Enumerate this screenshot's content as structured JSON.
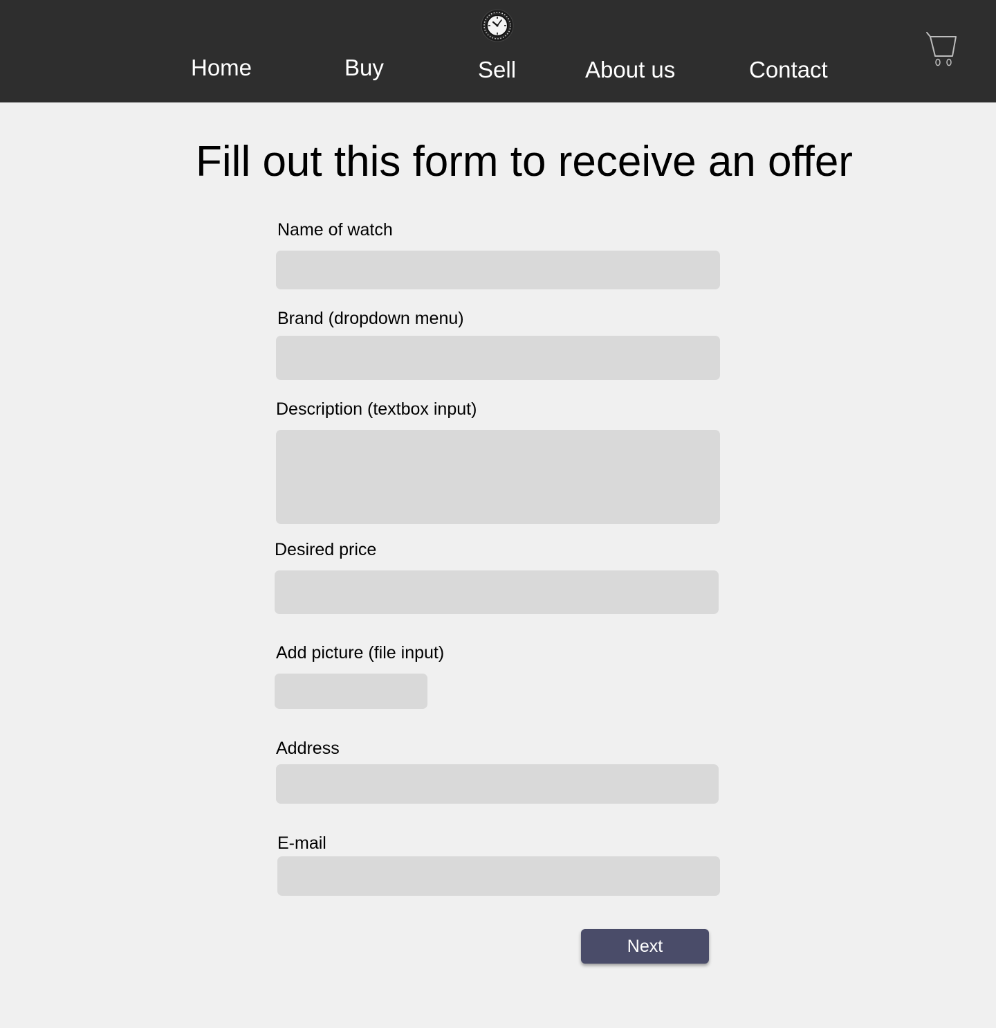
{
  "header": {
    "logo_icon": "watch-clock-icon",
    "nav": {
      "home": "Home",
      "buy": "Buy",
      "sell": "Sell",
      "about": "About us",
      "contact": "Contact"
    },
    "cart_icon": "shopping-cart-icon"
  },
  "form": {
    "title": "Fill out this form to receive an offer",
    "watch_name_label": "Name of watch",
    "brand_label": "Brand (dropdown menu)",
    "description_label": "Description (textbox input)",
    "price_label": "Desired price",
    "picture_label": "Add picture (file input)",
    "address_label": "Address",
    "email_label": "E-mail",
    "next_label": "Next"
  },
  "colors": {
    "header_bg": "#2e2e2e",
    "page_bg": "#f0f0f0",
    "field_bg": "#d9d9d9",
    "button_bg": "#4a4c69"
  }
}
